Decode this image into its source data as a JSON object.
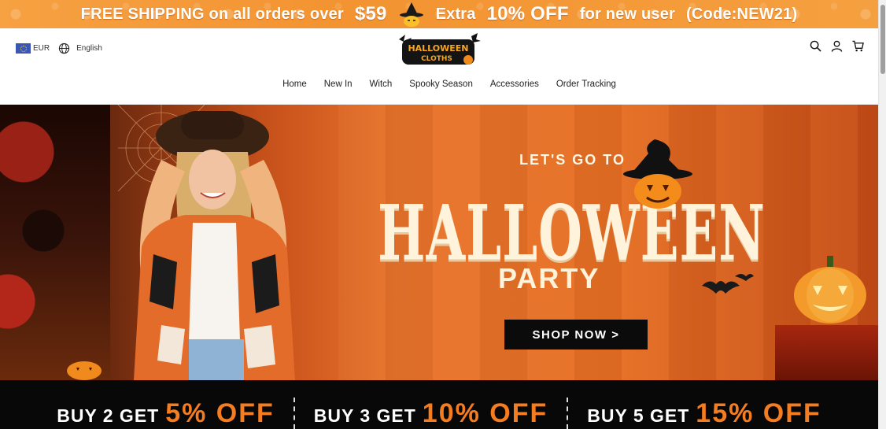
{
  "promo": {
    "part1": "FREE SHIPPING on all orders over",
    "amount": "$59",
    "part2": "Extra",
    "discount": "10% OFF",
    "part3": "for new user",
    "code": "(Code:NEW21)"
  },
  "header": {
    "currency": "EUR",
    "language": "English",
    "logo_line1": "HALLOWEEN",
    "logo_line2": "CLOTHS"
  },
  "nav": {
    "items": [
      "Home",
      "New In",
      "Witch",
      "Spooky Season",
      "Accessories",
      "Order Tracking"
    ]
  },
  "hero": {
    "kicker": "LET'S GO TO",
    "headline": "HALLOWEEN",
    "subhead": "PARTY",
    "cta": "SHOP NOW >"
  },
  "offers": [
    {
      "lead": "BUY 2 GET",
      "discount": "5% OFF"
    },
    {
      "lead": "BUY 3 GET",
      "discount": "10% OFF"
    },
    {
      "lead": "BUY 5 GET",
      "discount": "15% OFF"
    }
  ],
  "colors": {
    "promo_bg": "#f39331",
    "accent_orange": "#f57c1f",
    "cta_bg": "#0b0b0b",
    "offers_bg": "#080808"
  }
}
